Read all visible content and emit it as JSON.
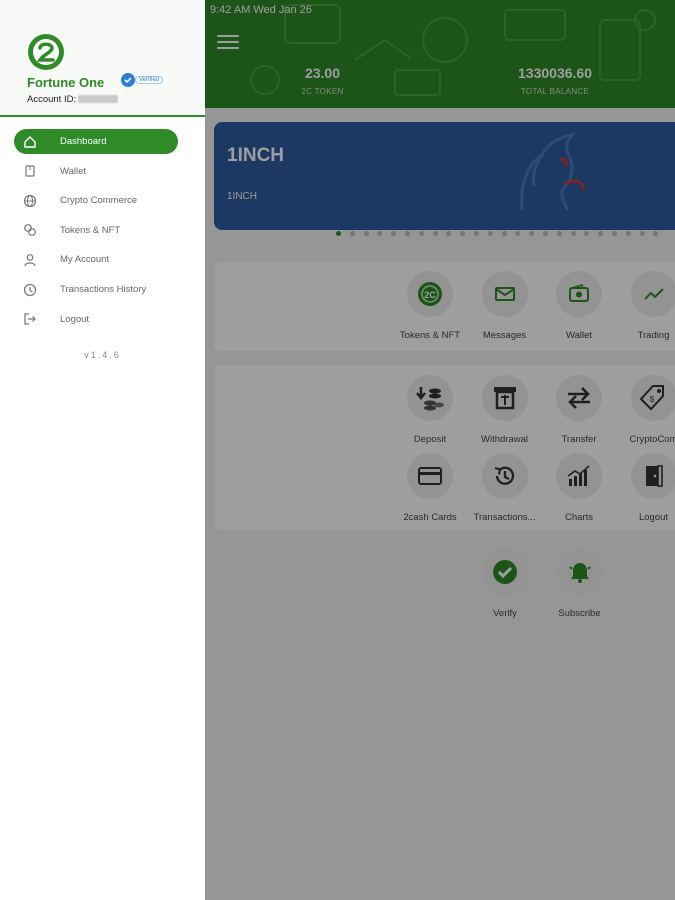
{
  "status_bar": {
    "time": "9:42 AM   Wed Jan 26"
  },
  "header": {
    "token": {
      "value": "23.00",
      "label": "2C TOKEN"
    },
    "balance": {
      "value": "1330036.60",
      "label": "TOTAL BALANCE"
    }
  },
  "banner": {
    "title": "1INCH",
    "subtitle": "1INCH",
    "color": "#2c5d9e",
    "art_icon": "unicorn-horse-icon"
  },
  "carousel": {
    "total_dots": 24,
    "active_index": 0
  },
  "quick_actions": [
    {
      "label": "Tokens & NFT",
      "icon": "token-coin-icon"
    },
    {
      "label": "Messages",
      "icon": "envelope-icon"
    },
    {
      "label": "Wallet",
      "icon": "wallet-icon"
    },
    {
      "label": "Trading",
      "icon": "trend-line-icon"
    }
  ],
  "services": [
    {
      "label": "Deposit",
      "icon": "coins-down-icon"
    },
    {
      "label": "Withdrawal",
      "icon": "atm-icon"
    },
    {
      "label": "Transfer",
      "icon": "arrows-exchange-icon"
    },
    {
      "label": "CryptoCom",
      "icon": "price-tag-icon"
    },
    {
      "label": "2cash Cards",
      "icon": "credit-card-icon"
    },
    {
      "label": "Transactions...",
      "icon": "history-clock-icon"
    },
    {
      "label": "Charts",
      "icon": "bar-chart-icon"
    },
    {
      "label": "Logout",
      "icon": "door-exit-icon"
    }
  ],
  "extras": [
    {
      "label": "Verify",
      "icon": "check-circle-icon"
    },
    {
      "label": "Subscribe",
      "icon": "bell-icon"
    }
  ],
  "profile": {
    "name": "Fortune One",
    "verified_badge": "Verified",
    "account_label": "Account ID:"
  },
  "nav": [
    {
      "label": "Dashboard",
      "icon": "home-icon",
      "active": true
    },
    {
      "label": "Wallet",
      "icon": "wallet-icon"
    },
    {
      "label": "Crypto Commerce",
      "icon": "globe-icon"
    },
    {
      "label": "Tokens & NFT",
      "icon": "tokens-icon"
    },
    {
      "label": "My Account",
      "icon": "user-icon"
    },
    {
      "label": "Transactions History",
      "icon": "clock-icon"
    },
    {
      "label": "Logout",
      "icon": "logout-icon"
    }
  ],
  "version": "v1.4.6",
  "colors": {
    "brand_green": "#2f8a28",
    "banner_blue": "#2c5d9e"
  }
}
